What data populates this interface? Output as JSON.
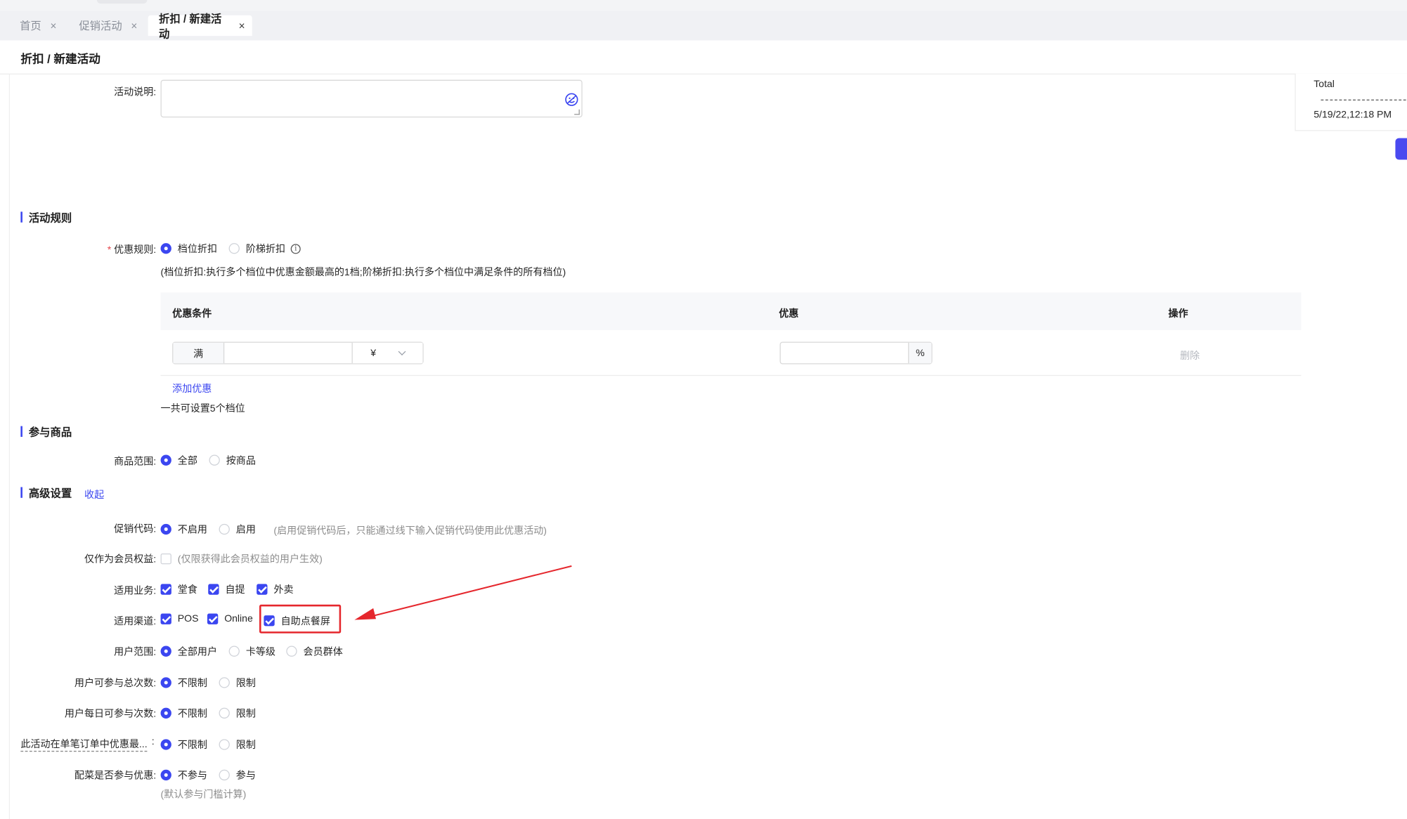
{
  "tabs": [
    {
      "label": "首页",
      "active": false
    },
    {
      "label": "促销活动",
      "active": false
    },
    {
      "label": "折扣 / 新建活动",
      "active": true
    }
  ],
  "close_glyph": "×",
  "page_title": "折扣 / 新建活动",
  "description": {
    "label": "活动说明:",
    "value": "",
    "icon": "emoji-icon"
  },
  "side_card": {
    "total_label": "Total",
    "timestamp": "5/19/22,12:18 PM"
  },
  "rules": {
    "section_title": "活动规则",
    "discount_rule": {
      "label": "优惠规则:",
      "required_mark": "*",
      "options": [
        "档位折扣",
        "阶梯折扣"
      ],
      "selected": "档位折扣"
    },
    "explanation": "(档位折扣:执行多个档位中优惠金额最高的1档;阶梯折扣:执行多个档位中满足条件的所有档位)",
    "table": {
      "headers": [
        "优惠条件",
        "优惠",
        "操作"
      ],
      "row": {
        "condition_prefix": "满",
        "condition_value": "",
        "currency": "¥",
        "discount_value": "",
        "discount_unit": "%",
        "action": "删除"
      }
    },
    "add_link": "添加优惠",
    "limit_note": "一共可设置5个档位"
  },
  "products": {
    "section_title": "参与商品",
    "scope": {
      "label": "商品范围:",
      "options": [
        "全部",
        "按商品"
      ],
      "selected": "全部"
    }
  },
  "advanced": {
    "section_title": "高级设置",
    "collapse_link": "收起",
    "promo_code": {
      "label": "促销代码:",
      "options": [
        "不启用",
        "启用"
      ],
      "selected": "不启用",
      "hint": "(启用促销代码后，只能通过线下输入促销代码使用此优惠活动)"
    },
    "member_only": {
      "label": "仅作为会员权益:",
      "checked": false,
      "hint": "(仅限获得此会员权益的用户生效)"
    },
    "business": {
      "label": "适用业务:",
      "options": [
        "堂食",
        "自提",
        "外卖"
      ],
      "checked": [
        true,
        true,
        true
      ]
    },
    "channels": {
      "label": "适用渠道:",
      "options": [
        "POS",
        "Online",
        "自助点餐屏"
      ],
      "checked": [
        true,
        true,
        true
      ]
    },
    "user_scope": {
      "label": "用户范围:",
      "options": [
        "全部用户",
        "卡等级",
        "会员群体"
      ],
      "selected": "全部用户"
    },
    "total_times": {
      "label": "用户可参与总次数:",
      "options": [
        "不限制",
        "限制"
      ],
      "selected": "不限制"
    },
    "daily_times": {
      "label": "用户每日可参与次数:",
      "options": [
        "不限制",
        "限制"
      ],
      "selected": "不限制"
    },
    "max_per_order": {
      "label": "此活动在单笔订单中优惠最...",
      "colon": ":",
      "options": [
        "不限制",
        "限制"
      ],
      "selected": "不限制"
    },
    "side_dish": {
      "label": "配菜是否参与优惠:",
      "options": [
        "不参与",
        "参与"
      ],
      "selected": "不参与",
      "hint": "(默认参与门槛计算)"
    }
  },
  "colors": {
    "accent": "#3b46f0",
    "annotation": "#e5272d"
  }
}
